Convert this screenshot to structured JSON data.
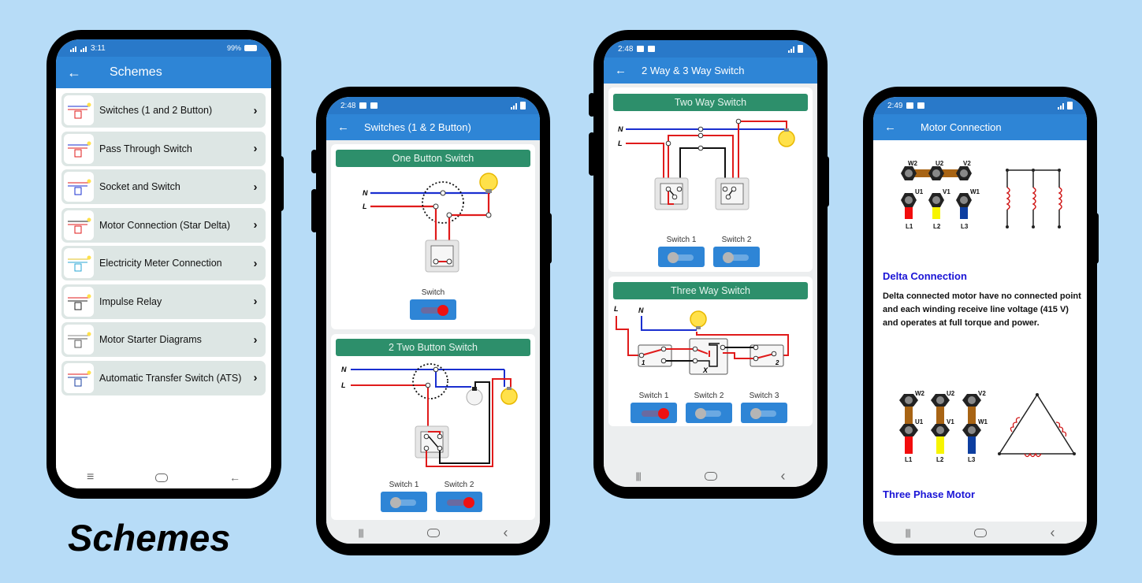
{
  "colors": {
    "background": "#b7dcf7",
    "appbar": "#2e85d6",
    "statusbar": "#2979c9",
    "card_header": "#2d8f6b",
    "list_item": "#dde6e4",
    "toggle_on": "#ee1111",
    "heading_blue": "#1a14d6",
    "wire_live": "#e01b1b",
    "wire_neutral": "#1a2fd0"
  },
  "caption": "Schemes",
  "phone1": {
    "status": {
      "time": "3:11",
      "signal_1": "4G",
      "signal_2": "3G",
      "battery": "99%"
    },
    "appbar": {
      "back_icon": "arrow-left-icon",
      "title": "Schemes"
    },
    "items": [
      {
        "label": "Switches (1 and 2 Button)",
        "icon": "switch-diagram-thumb"
      },
      {
        "label": "Pass Through Switch",
        "icon": "pass-through-thumb"
      },
      {
        "label": "Socket and Switch",
        "icon": "socket-thumb"
      },
      {
        "label": "Motor Connection (Star Delta)",
        "icon": "motor-thumb"
      },
      {
        "label": "Electricity Meter Connection",
        "icon": "meter-thumb"
      },
      {
        "label": "Impulse Relay",
        "icon": "relay-thumb"
      },
      {
        "label": "Motor Starter Diagrams",
        "icon": "starter-thumb"
      },
      {
        "label": "Automatic Transfer Switch (ATS)",
        "icon": "ats-thumb"
      }
    ],
    "chevron": "›"
  },
  "phone2": {
    "status": {
      "time": "2:48"
    },
    "appbar": {
      "back_icon": "arrow-left-icon",
      "title": "Switches (1 & 2 Button)"
    },
    "cards": [
      {
        "header": "One Button Switch",
        "wire_labels": [
          "N",
          "L"
        ],
        "switches": [
          {
            "label": "Switch",
            "on": true
          }
        ]
      },
      {
        "header": "2 Two Button Switch",
        "wire_labels": [
          "N",
          "L"
        ],
        "switches": [
          {
            "label": "Switch 1",
            "on": false
          },
          {
            "label": "Switch 2",
            "on": true
          }
        ]
      }
    ]
  },
  "phone3": {
    "status": {
      "time": "2:48"
    },
    "appbar": {
      "back_icon": "arrow-left-icon",
      "title": "2 Way & 3 Way Switch"
    },
    "cards": [
      {
        "header": "Two Way Switch",
        "wire_labels": [
          "N",
          "L"
        ],
        "switches": [
          {
            "label": "Switch 1",
            "on": false
          },
          {
            "label": "Switch 2",
            "on": false
          }
        ]
      },
      {
        "header": "Three Way Switch",
        "wire_labels": [
          "L",
          "N"
        ],
        "diagram_labels": [
          "1",
          "X",
          "2"
        ],
        "switches": [
          {
            "label": "Switch 1",
            "on": true
          },
          {
            "label": "Switch 2",
            "on": false
          },
          {
            "label": "Switch 3",
            "on": false
          }
        ]
      }
    ]
  },
  "phone4": {
    "status": {
      "time": "2:49"
    },
    "appbar": {
      "back_icon": "arrow-left-icon",
      "title": "Motor Connection"
    },
    "terminal_labels": {
      "top": [
        "W2",
        "U2",
        "V2"
      ],
      "mid": [
        "U1",
        "V1",
        "W1"
      ],
      "lines": [
        "L1",
        "L2",
        "L3"
      ]
    },
    "sections": [
      {
        "heading": "Delta Connection",
        "text": "Delta connected motor have no connected point and each winding receive line voltage (415 V) and operates at full torque and power."
      },
      {
        "heading": "Three Phase Motor"
      }
    ]
  },
  "nav": {
    "recent": "|||",
    "back": "‹",
    "back_arrow": "←"
  }
}
